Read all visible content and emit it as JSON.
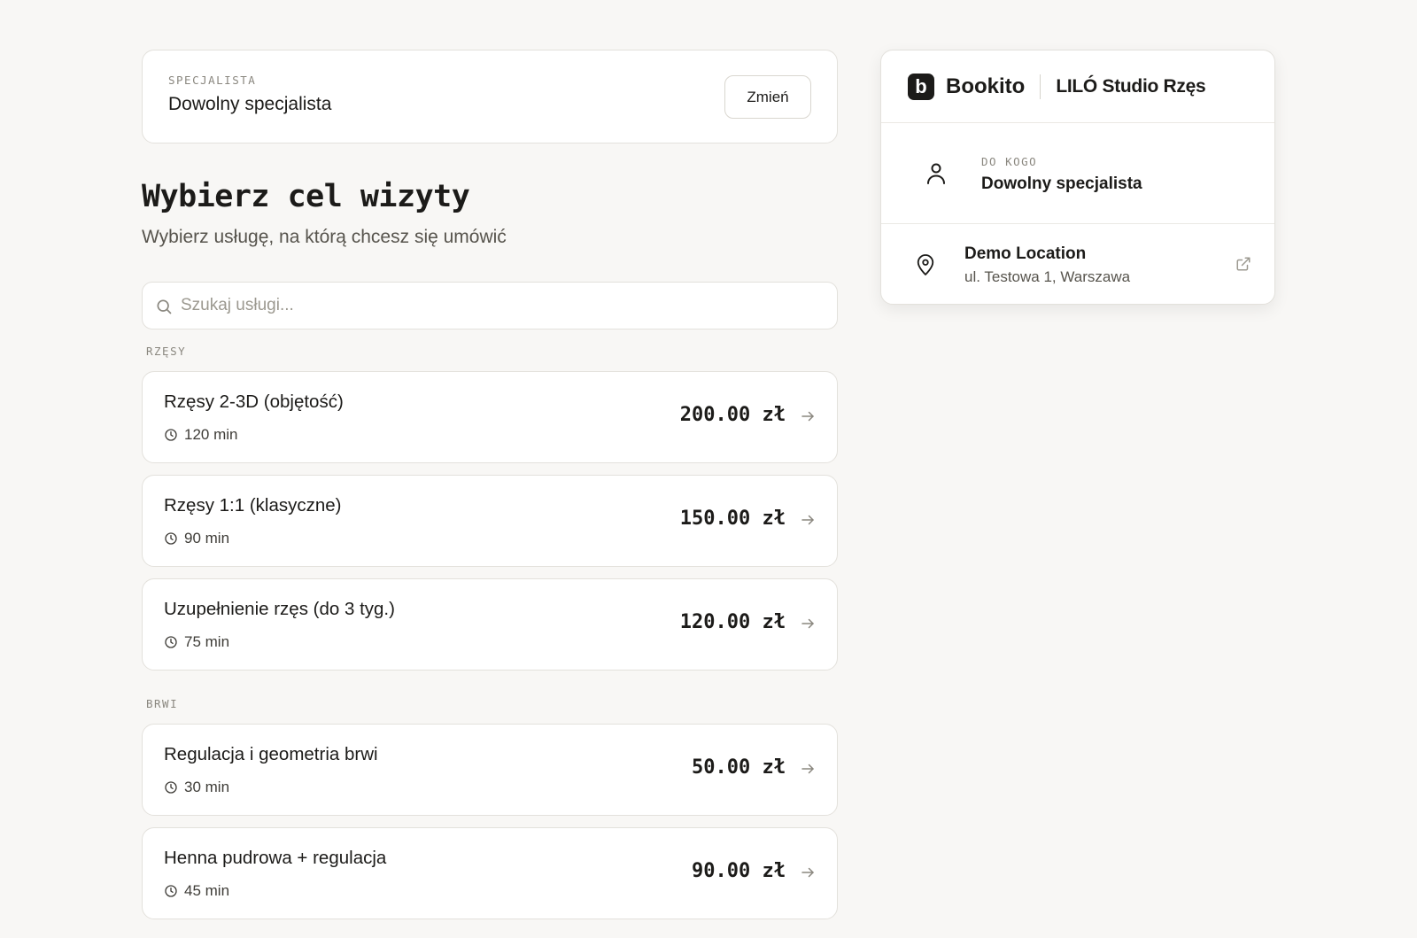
{
  "specialist": {
    "eyebrow": "SPECJALISTA",
    "name": "Dowolny specjalista",
    "change_label": "Zmień"
  },
  "main": {
    "title": "Wybierz cel wizyty",
    "subtitle": "Wybierz usługę, na którą chcesz się umówić"
  },
  "search": {
    "placeholder": "Szukaj usługi...",
    "value": ""
  },
  "sections": [
    {
      "label": "RZĘSY",
      "services": [
        {
          "name": "Rzęsy 2-3D (objętość)",
          "duration": "120 min",
          "price": "200.00 zł"
        },
        {
          "name": "Rzęsy 1:1 (klasyczne)",
          "duration": "90 min",
          "price": "150.00 zł"
        },
        {
          "name": "Uzupełnienie rzęs (do 3 tyg.)",
          "duration": "75 min",
          "price": "120.00 zł"
        }
      ]
    },
    {
      "label": "BRWI",
      "services": [
        {
          "name": "Regulacja i geometria brwi",
          "duration": "30 min",
          "price": "50.00 zł"
        },
        {
          "name": "Henna pudrowa + regulacja",
          "duration": "45 min",
          "price": "90.00 zł"
        }
      ]
    }
  ],
  "summary": {
    "brand_logo_letter": "b",
    "brand_name": "Bookito",
    "studio_name": "LILÓ Studio Rzęs",
    "who_eyebrow": "DO KOGO",
    "who_value": "Dowolny specjalista",
    "location_name": "Demo Location",
    "location_address": "ul. Testowa 1, Warszawa"
  },
  "icons": {
    "search": "search-icon",
    "clock": "clock-icon",
    "arrow": "arrow-right-icon",
    "person": "person-icon",
    "pin": "map-pin-icon",
    "external": "external-link-icon"
  }
}
